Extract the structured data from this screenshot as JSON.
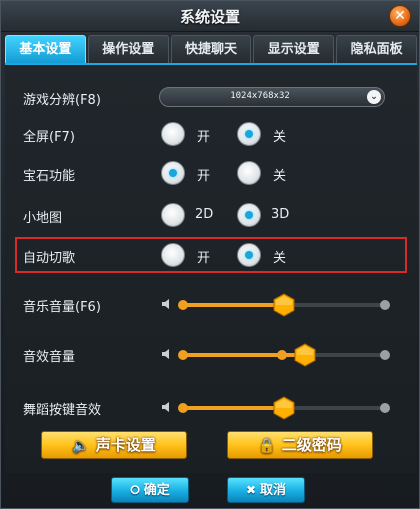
{
  "window": {
    "title": "系统设置",
    "close_glyph": "✕"
  },
  "tabs": [
    {
      "label": "基本设置",
      "active": true
    },
    {
      "label": "操作设置",
      "active": false
    },
    {
      "label": "快捷聊天",
      "active": false
    },
    {
      "label": "显示设置",
      "active": false
    },
    {
      "label": "隐私面板",
      "active": false
    }
  ],
  "resolution": {
    "label": "游戏分辨(F8)",
    "value": "1024x768x32"
  },
  "fullscreen": {
    "label": "全屏(F7)",
    "options": [
      "开",
      "关"
    ],
    "selected": "关"
  },
  "gem": {
    "label": "宝石功能",
    "options": [
      "开",
      "关"
    ],
    "selected": "开"
  },
  "minimap": {
    "label": "小地图",
    "options": [
      "2D",
      "3D"
    ],
    "selected": "3D"
  },
  "auto_song": {
    "label": "自动切歌",
    "options": [
      "开",
      "关"
    ],
    "selected": "关"
  },
  "music_volume": {
    "label": "音乐音量(F6)",
    "level": 0.5
  },
  "sfx_volume": {
    "label": "音效音量",
    "level": 0.6
  },
  "dance_key_volume": {
    "label": "舞蹈按键音效",
    "level": 0.5
  },
  "buttons": {
    "sound_card": "声卡设置",
    "secondary_password": "二级密码",
    "confirm": "确定",
    "cancel": "取消"
  },
  "icons": {
    "close": "close-icon",
    "dropdown": "chevron-down-icon",
    "speaker": "speaker-icon",
    "sound_card": "speaker-icon",
    "lock": "lock-icon",
    "confirm": "circle-icon",
    "cancel": "x-icon"
  },
  "colors": {
    "accent": "#1aa8df",
    "highlight_border": "#d82a2a",
    "slider_fill": "#f0a020",
    "gold_button": "#ffc21a"
  }
}
